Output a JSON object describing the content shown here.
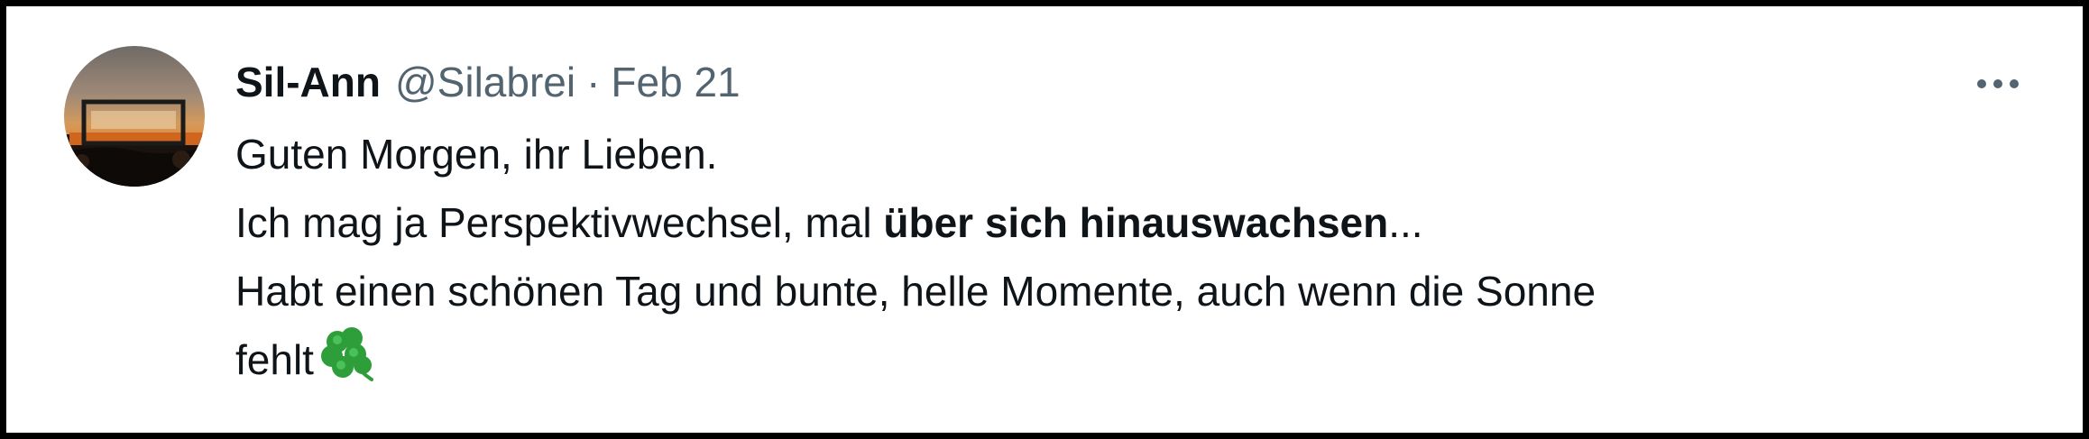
{
  "tweet": {
    "author": {
      "display_name": "Sil-Ann",
      "handle": "@Silabrei"
    },
    "separator": "·",
    "date": "Feb 21",
    "more_icon": "more-horizontal-icon",
    "text": {
      "line1": "Guten Morgen, ihr Lieben.",
      "line2_pre": "Ich mag ja Perspektivwechsel, mal ",
      "line2_bold": "über sich hinauswachsen",
      "line2_post": "...",
      "line3": "Habt einen schönen Tag und bunte, helle Momente, auch wenn die Sonne",
      "line4": "fehlt",
      "emoji": "shamrock-icon"
    }
  },
  "colors": {
    "text_primary": "#0f1419",
    "text_secondary": "#536471",
    "clover": "#2e9e3a",
    "border": "#000000"
  }
}
